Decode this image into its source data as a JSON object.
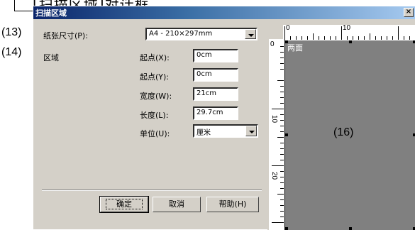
{
  "doc_caption": "[扫描区域]对话框",
  "callouts": {
    "c13": "(13)",
    "c14": "(14)",
    "c16": "(16)"
  },
  "dialog": {
    "title": "扫描区域",
    "close_label": "×",
    "paper_size_label": "纸张尺寸(P):",
    "paper_size_value": "A4 - 210×297mm",
    "region_label": "区域",
    "fields": [
      {
        "label": "起点(X):",
        "value": "0cm"
      },
      {
        "label": "起点(Y):",
        "value": "0cm"
      },
      {
        "label": "宽度(W):",
        "value": "21cm"
      },
      {
        "label": "长度(L):",
        "value": "29.7cm"
      }
    ],
    "unit_label": "单位(U):",
    "unit_value": "厘米",
    "buttons": {
      "ok": "确定",
      "cancel": "取消",
      "help": "帮助(H)"
    }
  },
  "preview": {
    "area_label": "两面",
    "ruler_top_labels": [
      "0",
      "10"
    ],
    "ruler_left_labels": [
      "0",
      "10",
      "20"
    ]
  }
}
